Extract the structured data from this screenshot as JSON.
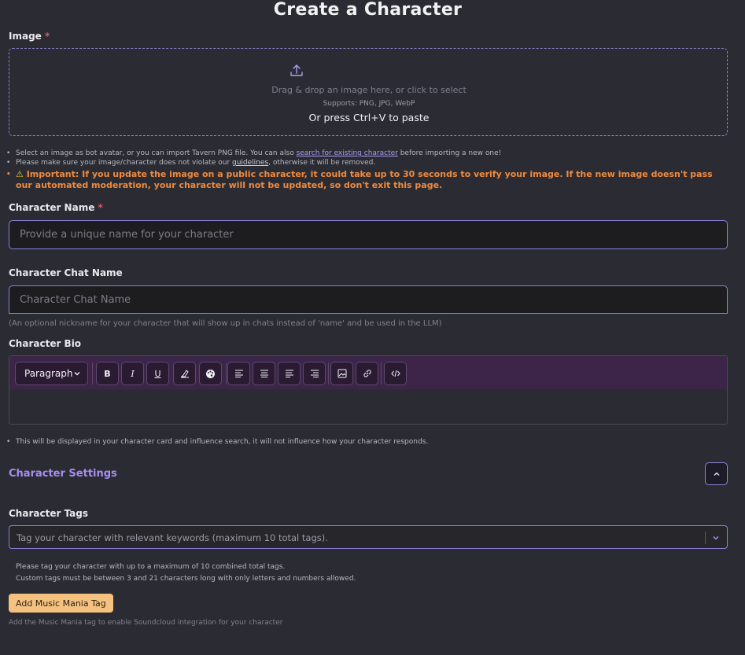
{
  "page": {
    "title": "Create a Character"
  },
  "image": {
    "label": "Image",
    "required_mark": "*",
    "dropzone_text": "Drag & drop an image here, or click to select",
    "supports": "Supports: PNG, JPG, WebP",
    "paste_hint": "Or press Ctrl+V to paste",
    "upload_icon": "upload-icon"
  },
  "notes": {
    "note1_prefix": "Select an image as bot avatar, or you can import Tavern PNG file. You can also ",
    "note1_link": "search for existing character",
    "note1_suffix": " before importing a new one!",
    "note2_prefix": "Please make sure your image/character does not violate our ",
    "note2_link": "guidelines",
    "note2_suffix": ", otherwise it will be removed.",
    "warning_icon": "⚠",
    "warning_strong": "Important:",
    "warning_text": " If you update the image on a public character, it could take up to 30 seconds to verify your image. If the new image doesn't pass our automated moderation, your character will not be updated, so don't exit this page."
  },
  "character_name": {
    "label": "Character Name",
    "required_mark": "*",
    "value": "",
    "placeholder": "Provide a unique name for your character"
  },
  "chat_name": {
    "label": "Character Chat Name",
    "value": "",
    "placeholder": "Character Chat Name",
    "hint": "(An optional nickname for your character that will show up in chats instead of 'name' and be used in the LLM)"
  },
  "bio": {
    "label": "Character Bio",
    "toolbar": {
      "paragraph": "Paragraph",
      "bold": "B",
      "italic": "I",
      "underline": "U"
    },
    "note": "This will be displayed in your character card and influence search, it will not influence how your character responds."
  },
  "settings": {
    "title": "Character Settings"
  },
  "tags": {
    "label": "Character Tags",
    "placeholder": "Tag your character with relevant keywords (maximum 10 total tags).",
    "help1": "Please tag your character with up to a maximum of 10 combined total tags.",
    "help2": "Custom tags must be between 3 and 21 characters long with only letters and numbers allowed."
  },
  "music": {
    "button": "Add Music Mania Tag",
    "hint": "Add the Music Mania tag to enable Soundcloud integration for your character"
  },
  "colors": {
    "background": "#2b2c33",
    "accent": "#8d7fd8",
    "toolbar": "#3c2549",
    "warning": "#f08a3e",
    "music_button": "#f4c27e",
    "required": "#e05561"
  }
}
